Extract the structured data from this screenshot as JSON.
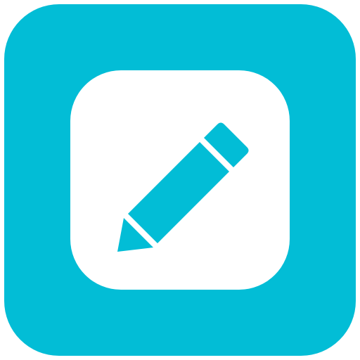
{
  "icon": {
    "name": "pencil-icon",
    "label": "",
    "colors": {
      "background": "#02BDD6",
      "tile": "#FFFFFF",
      "glyph": "#02BDD6"
    }
  }
}
